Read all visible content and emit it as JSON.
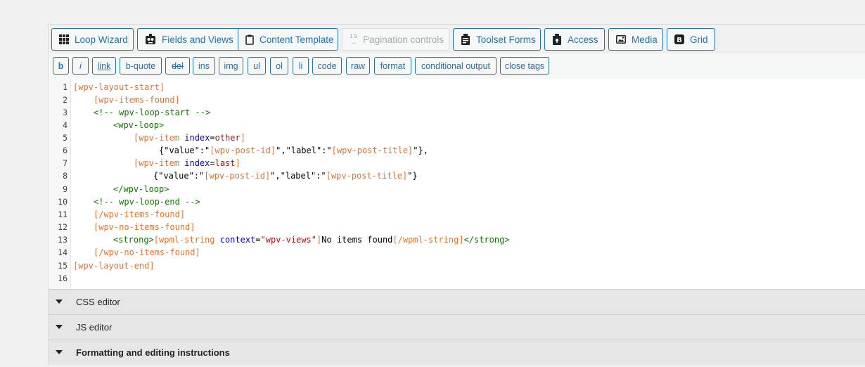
{
  "toolbar": {
    "buttons": [
      {
        "label": "Loop Wizard",
        "icon": "grid-icon"
      },
      {
        "label": "Fields and Views",
        "icon": "robot-icon"
      },
      {
        "label": "Content Template",
        "icon": "clipboard-icon"
      },
      {
        "label": "Pagination controls",
        "icon": "pagination-icon",
        "disabled": true
      },
      {
        "label": "Toolset Forms",
        "icon": "forms-icon"
      },
      {
        "label": "Access",
        "icon": "lock-icon"
      },
      {
        "label": "Media",
        "icon": "image-icon"
      },
      {
        "label": "Grid",
        "icon": "bootstrap-icon"
      }
    ],
    "pagination_icon_text": "1 9"
  },
  "quicktags": [
    "b",
    "i",
    "link",
    "b-quote",
    "del",
    "ins",
    "img",
    "ul",
    "ol",
    "li",
    "code",
    "raw",
    "format",
    "conditional output",
    "close tags"
  ],
  "editor": {
    "line_numbers": [
      "1",
      "2",
      "3",
      "4",
      "5",
      "6",
      "7",
      "8",
      "9",
      "10",
      "11",
      "12",
      "13",
      "14",
      "15",
      "16"
    ],
    "lines": {
      "l1": "[wpv-layout-start]",
      "l2": "[wpv-items-found]",
      "l3": "<!-- wpv-loop-start -->",
      "l4": "<wpv-loop>",
      "l5a": "[wpv-item ",
      "l5b": "index",
      "l5c": "=",
      "l5d": "other",
      "l5e": "]",
      "l6a": "{\"value\":\"",
      "l6b": "[wpv-post-id]",
      "l6c": "\",\"label\":\"",
      "l6d": "[wpv-post-title]",
      "l6e": "\"},",
      "l7a": "[wpv-item ",
      "l7b": "index",
      "l7c": "=",
      "l7d": "last",
      "l7e": "]",
      "l8a": "{\"value\":\"",
      "l8b": "[wpv-post-id]",
      "l8c": "\",\"label\":\"",
      "l8d": "[wpv-post-title]",
      "l8e": "\"}",
      "l9": "</wpv-loop>",
      "l10": "<!-- wpv-loop-end -->",
      "l11": "[/wpv-items-found]",
      "l12": "[wpv-no-items-found]",
      "l13a": "<strong>",
      "l13b": "[wpml-string ",
      "l13c": "context",
      "l13d": "=",
      "l13e": "\"wpv-views\"",
      "l13f": "]",
      "l13g": "No items found",
      "l13h": "[/wpml-string]",
      "l13i": "</strong>",
      "l14": "[/wpv-no-items-found]",
      "l15": "[wpv-layout-end]"
    }
  },
  "sections": [
    {
      "label": "CSS editor"
    },
    {
      "label": "JS editor"
    },
    {
      "label": "Formatting and editing instructions"
    }
  ]
}
